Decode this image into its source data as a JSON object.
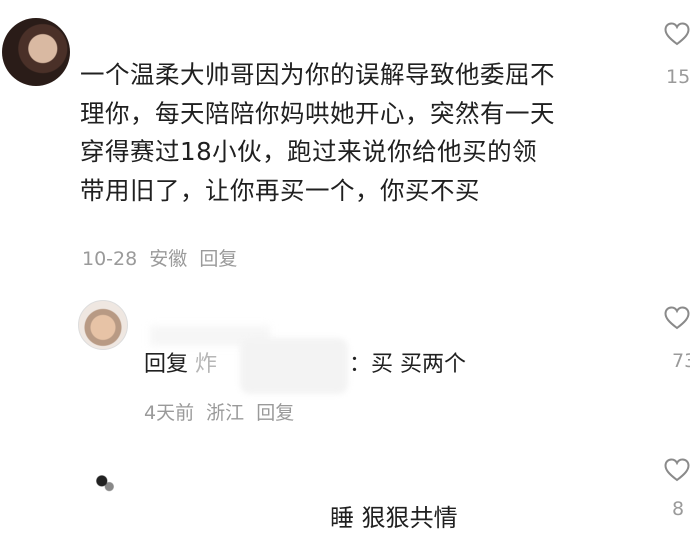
{
  "comment": {
    "lines": [
      "一个温柔大帅哥因为你的误解导致他委屈不",
      "理你，每天陪陪你妈哄她开心，突然有一天",
      "穿得赛过18小伙，跑过来说你给他买的领",
      "带用旧了，让你再买一个，你买不买"
    ],
    "date": "10-28",
    "location": "安徽",
    "reply_label": "回复",
    "like_count": "15"
  },
  "reply": {
    "prefix": "回复",
    "user_partial": "炸",
    "text": "：买 买两个",
    "date": "4天前",
    "location": "浙江",
    "reply_label": "回复",
    "like_count": "73"
  },
  "reply2": {
    "text": "睡 狠狠共情",
    "like_count": "8"
  },
  "icons": {
    "like": "heart-outline-icon"
  },
  "colors": {
    "text": "#202020",
    "meta": "#9a9a9a"
  }
}
